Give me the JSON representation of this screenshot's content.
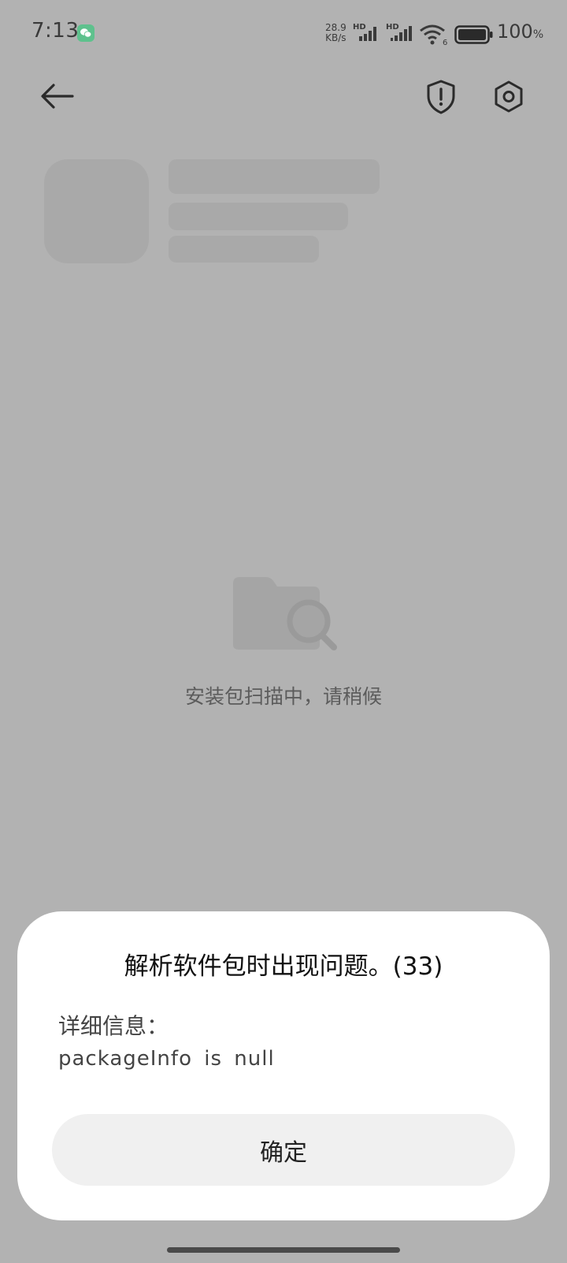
{
  "status_bar": {
    "time": "7:13",
    "app_icon": "wechat-icon",
    "net_speed_value": "28.9",
    "net_speed_unit": "KB/s",
    "signal_1_label": "HD",
    "signal_2_label": "HD",
    "wifi_badge": "6",
    "battery_percent": "100",
    "battery_unit": "%"
  },
  "toolbar": {
    "back_icon": "back-arrow-icon",
    "shield_icon": "security-shield-icon",
    "settings_icon": "settings-hexagon-icon"
  },
  "scan": {
    "illustration_icon": "folder-search-icon",
    "message": "安装包扫描中，请稍候"
  },
  "dialog": {
    "title": "解析软件包时出现问题。(33)",
    "detail_label": "详细信息：",
    "detail_message": "packageInfo is null",
    "confirm_label": "确定"
  },
  "colors": {
    "overlay_background": "#b2b2b2",
    "skeleton": "#a9a9a9",
    "dialog_background": "#ffffff",
    "button_background": "#f0f0f0",
    "wechat_green": "#5ec18d"
  }
}
